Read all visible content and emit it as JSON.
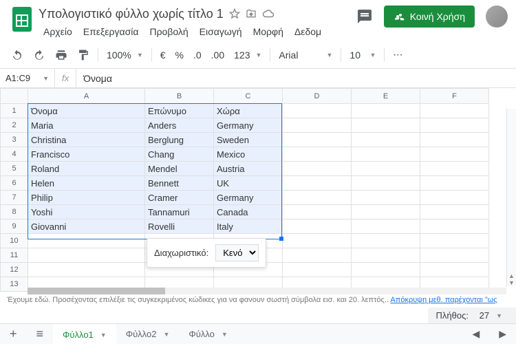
{
  "doc": {
    "title": "Υπολογιστικό φύλλο χωρίς τίτλο 1"
  },
  "menus": [
    "Αρχείο",
    "Επεξεργασία",
    "Προβολή",
    "Εισαγωγή",
    "Μορφή",
    "Δεδομ"
  ],
  "share": "Κοινή Χρήση",
  "toolbar": {
    "zoom": "100%",
    "fmt": "123",
    "font": "Arial",
    "size": "10"
  },
  "namebox": "A1:C9",
  "fx_label": "fx",
  "fx_value": "Όνομα",
  "colHeaders": [
    "A",
    "B",
    "C",
    "D",
    "E",
    "F"
  ],
  "rows": [
    [
      "Όνομα",
      "Επώνυμο",
      "Χώρα",
      "",
      "",
      ""
    ],
    [
      "Maria",
      "Anders",
      "Germany",
      "",
      "",
      ""
    ],
    [
      "Christina",
      "Berglung",
      "Sweden",
      "",
      "",
      ""
    ],
    [
      "Francisco",
      "Chang",
      "Mexico",
      "",
      "",
      ""
    ],
    [
      "Roland",
      "Mendel",
      "Austria",
      "",
      "",
      ""
    ],
    [
      "Helen",
      "Bennett",
      "UK",
      "",
      "",
      ""
    ],
    [
      "Philip",
      "Cramer",
      "Germany",
      "",
      "",
      ""
    ],
    [
      "Yoshi",
      "Tannamuri",
      "Canada",
      "",
      "",
      ""
    ],
    [
      "Giovanni",
      "Rovelli",
      "Italy",
      "",
      "",
      ""
    ],
    [
      "",
      "",
      "",
      "",
      "",
      ""
    ],
    [
      "",
      "",
      "",
      "",
      "",
      ""
    ],
    [
      "",
      "",
      "",
      "",
      "",
      ""
    ],
    [
      "",
      "",
      "",
      "",
      "",
      ""
    ]
  ],
  "selection": {
    "startRow": 0,
    "endRow": 8,
    "startCol": 0,
    "endCol": 2
  },
  "popup": {
    "label": "Διαχωριστικό:",
    "value": "Κενό"
  },
  "info": {
    "text": "Έχουμε εδώ. Προσέχοντας επιλέξιε τις συγκεκριμένος κώδικες για να φανουν σωστή σύμβολα εισ. και 20. λεπτός.. ",
    "link": "Απόκρυψη μεθ. παρέχονται \"ως"
  },
  "status": {
    "label": "Πλήθος:",
    "value": "27"
  },
  "sheets": [
    "Φύλλο1",
    "Φύλλο2",
    "Φύλλο"
  ]
}
